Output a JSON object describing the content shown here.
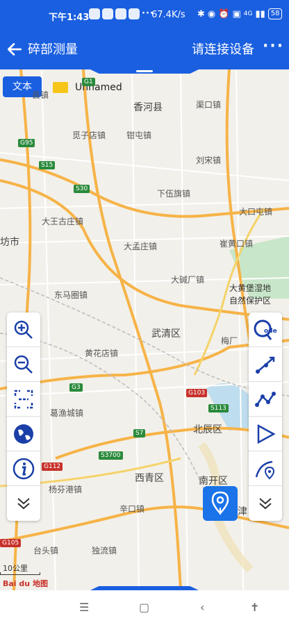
{
  "status": {
    "time": "下午1:43",
    "speed": "67.4K/s",
    "network": "4G",
    "battery": "58"
  },
  "appbar": {
    "title": "碎部测量",
    "connect": "请连接设备"
  },
  "map": {
    "text_button": "文本",
    "folder_label": "Unnamed",
    "places": [
      {
        "name": "香河县",
        "big": true
      },
      {
        "name": "渠口镇"
      },
      {
        "name": "觅子店镇"
      },
      {
        "name": "钳屯镇"
      },
      {
        "name": "刘宋镇"
      },
      {
        "name": "下伍旗镇"
      },
      {
        "name": "大口屯镇"
      },
      {
        "name": "大王古庄镇"
      },
      {
        "name": "大孟庄镇"
      },
      {
        "name": "崔黄口镇"
      },
      {
        "name": "大碱厂镇"
      },
      {
        "name": "大黄堡湿地"
      },
      {
        "name": "自然保护区"
      },
      {
        "name": "东马圈镇"
      },
      {
        "name": "武清区",
        "big": true
      },
      {
        "name": "梅厂"
      },
      {
        "name": "黄花店镇"
      },
      {
        "name": "葛渔城镇"
      },
      {
        "name": "北辰区",
        "big": true
      },
      {
        "name": "杨芬港镇"
      },
      {
        "name": "西青区",
        "big": true
      },
      {
        "name": "南开区",
        "big": true
      },
      {
        "name": "辛口镇"
      },
      {
        "name": "台头镇"
      },
      {
        "name": "独流镇"
      },
      {
        "name": "津",
        "big": true
      },
      {
        "name": "坊市",
        "big": true
      },
      {
        "name": "县镇"
      }
    ],
    "highways": [
      "G1",
      "G95",
      "S15",
      "S30",
      "G3",
      "G103",
      "S113",
      "S7",
      "S3700",
      "G112",
      "G105"
    ],
    "scale_label": "10公里",
    "logo": "Bai du 地图"
  },
  "tools_left": [
    "zoom-in",
    "zoom-out",
    "fullscreen",
    "globe",
    "info",
    "expand"
  ],
  "tools_right": [
    "code-search",
    "line",
    "polyline",
    "play",
    "curve-pin",
    "expand"
  ]
}
